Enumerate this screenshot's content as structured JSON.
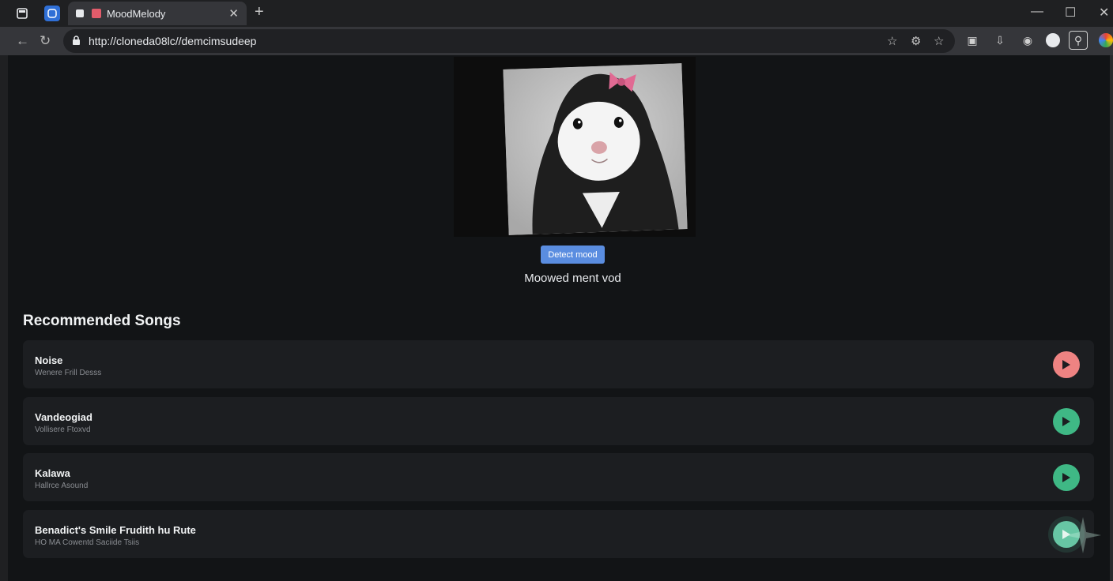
{
  "browser": {
    "tab_title": "MoodMelody",
    "url": "http://cloneda08lc//demcimsudeep"
  },
  "page": {
    "detect_button_label": "Detect mood",
    "mood_result": "Moowed ment vod",
    "section_title": "Recommended Songs",
    "songs": [
      {
        "name": "Noise",
        "artist": "Wenere Frill Desss",
        "play_color": "#ee8382"
      },
      {
        "name": "Vandeogiad",
        "artist": "Vollisere Ftoxvd",
        "play_color": "#3fb885"
      },
      {
        "name": "Kalawa",
        "artist": "Hallrce Asound",
        "play_color": "#3fb885"
      },
      {
        "name": "Benadict's Smile Frudith hu Rute",
        "artist": "HO MA Cowentd Saciide Tsiis",
        "play_color": "#67c6a4"
      }
    ]
  },
  "icons": [
    "tab-menu-icon",
    "workspace-icon",
    "document-icon",
    "close-icon",
    "plus-icon",
    "minimize-icon",
    "maximize-icon",
    "back-icon",
    "reload-icon",
    "lock-icon",
    "star-icon",
    "play-icon"
  ]
}
